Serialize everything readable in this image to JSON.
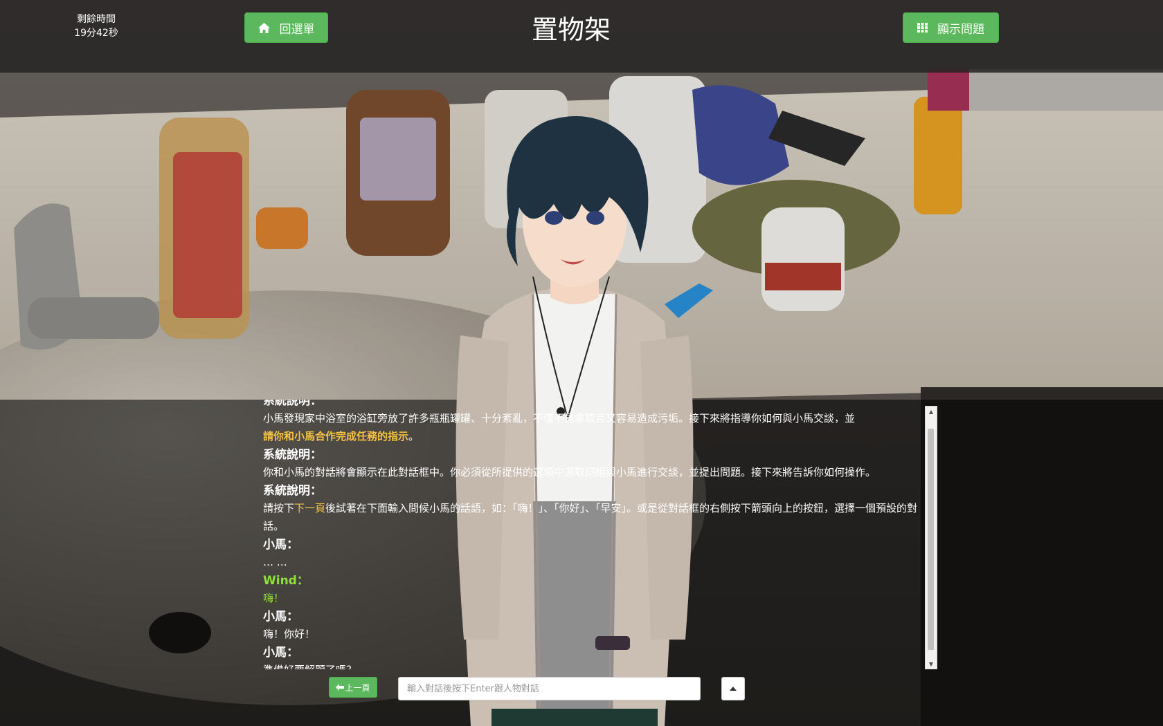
{
  "timer": {
    "label": "剩餘時間",
    "value": "19分42秒"
  },
  "header": {
    "menu_button": "回選單",
    "title": "置物架",
    "questions_button": "顯示問題"
  },
  "dialogue": {
    "cut_top_label": "系統說明：",
    "entries": [
      {
        "text_before": "小馬發現家中浴室的浴缸旁放了許多瓶瓶罐罐、十分紊亂，不僅不易拿取且又容易造成污垢。接下來將指導你如何與小馬交談，並",
        "highlight": "請你和小馬合作完成任務的指示",
        "text_after": "。"
      },
      {
        "speaker": "系統說明：",
        "text": "你和小馬的對話將會顯示在此對話框中。你必須從所提供的選項中選取詞組與小馬進行交談，並提出問題。接下來將告訴你如何操作。"
      },
      {
        "speaker": "系統說明：",
        "text_before": "請按下",
        "highlight": "下一頁",
        "text_after": "後試著在下面輸入問候小馬的話語，如：「嗨！」、「你好」、「早安」。或是從對話框的右側按下箭頭向上的按鈕，選擇一個預設的對話。"
      },
      {
        "speaker": "小馬：",
        "text": "… …"
      },
      {
        "speaker": "Wind：",
        "text": "嗨！"
      },
      {
        "speaker": "小馬：",
        "text": "嗨！你好！"
      },
      {
        "speaker": "小馬：",
        "text": "準備好要解題了嗎？"
      }
    ]
  },
  "controls": {
    "prev_button": "上一頁",
    "input_placeholder": "輸入對話後按下Enter跟人物對話",
    "input_value": ""
  },
  "colors": {
    "button_green": "#5cb85c",
    "highlight_yellow": "#f5c242",
    "player_name_green": "#8fe03a"
  },
  "icons": {
    "menu_button": "home-icon",
    "questions_button": "grid-icon",
    "prev_button": "arrow-left-icon",
    "preset_button": "caret-up-icon"
  }
}
